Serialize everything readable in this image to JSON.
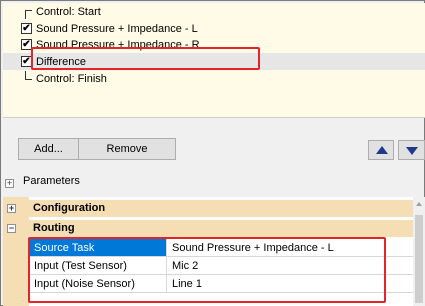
{
  "tasks": [
    {
      "label": "Control: Start",
      "kind": "start"
    },
    {
      "label": "Sound Pressure + Impedance - L",
      "kind": "checked"
    },
    {
      "label": "Sound Pressure + Impedance - R",
      "kind": "checked",
      "selected": true
    },
    {
      "label": "Difference",
      "kind": "checked"
    },
    {
      "label": "Control: Finish",
      "kind": "finish"
    }
  ],
  "checkmark": "✔",
  "buttons": {
    "add": "Add...",
    "remove": "Remove"
  },
  "icons": {
    "up": "arrow-up-icon",
    "down": "arrow-down-icon"
  },
  "parameters": {
    "expander": "+",
    "label": "Parameters"
  },
  "grid": {
    "categories": [
      {
        "expander": "+",
        "label": "Configuration"
      },
      {
        "expander": "−",
        "label": "Routing"
      }
    ],
    "properties": [
      {
        "name": "Source Task",
        "value": "Sound Pressure + Impedance - L",
        "selected": true
      },
      {
        "name": "Input (Test Sensor)",
        "value": "Mic 2"
      },
      {
        "name": "Input (Noise Sensor)",
        "value": "Line 1"
      }
    ]
  },
  "colors": {
    "highlight": "#e3242b",
    "selection": "#0078d7",
    "category_band": "#f5deb3",
    "task_panel": "#fffbe6"
  }
}
